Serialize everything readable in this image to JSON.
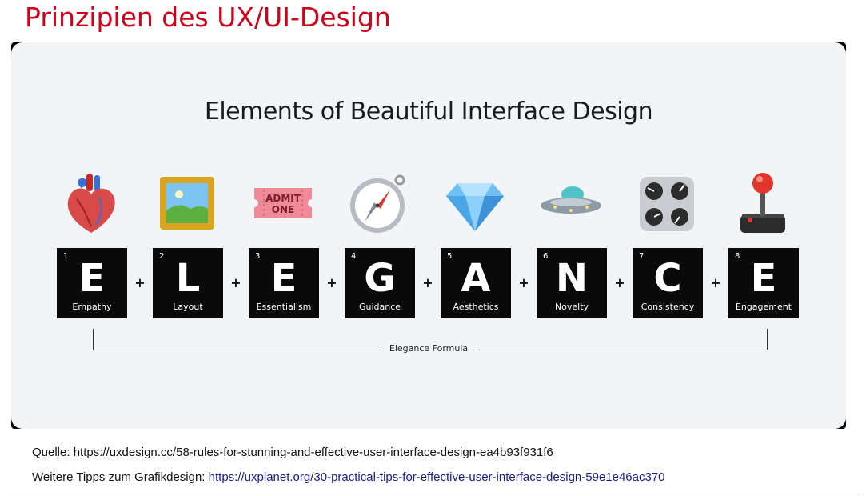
{
  "slide_title": "Prinzipien des UX/UI-Design",
  "graphic": {
    "heading": "Elements of Beautiful Interface Design",
    "operator": "+",
    "formula_label": "Elegance Formula",
    "tiles": [
      {
        "number": "1",
        "letter": "E",
        "word": "Empathy",
        "icon": "anatomical-heart-icon"
      },
      {
        "number": "2",
        "letter": "L",
        "word": "Layout",
        "icon": "framed-picture-icon"
      },
      {
        "number": "3",
        "letter": "E",
        "word": "Essentialism",
        "icon": "admission-ticket-icon",
        "icon_text": "ADMIT ONE"
      },
      {
        "number": "4",
        "letter": "G",
        "word": "Guidance",
        "icon": "compass-icon"
      },
      {
        "number": "5",
        "letter": "A",
        "word": "Aesthetics",
        "icon": "gem-icon"
      },
      {
        "number": "6",
        "letter": "N",
        "word": "Novelty",
        "icon": "flying-saucer-icon"
      },
      {
        "number": "7",
        "letter": "C",
        "word": "Consistency",
        "icon": "control-knobs-icon"
      },
      {
        "number": "8",
        "letter": "E",
        "word": "Engagement",
        "icon": "joystick-icon"
      }
    ]
  },
  "source": {
    "text": "Quelle: https://uxdesign.cc/58-rules-for-stunning-and-effective-user-interface-design-ea4b93f931f6"
  },
  "tips": {
    "prefix": "Weitere Tipps zum Grafikdesign: ",
    "link": "https://uxplanet.org/30-practical-tips-for-effective-user-interface-design-59e1e46ac370"
  },
  "colors": {
    "title": "#d0021b",
    "panel": "#f2f5f8",
    "tile": "#0a0a0a",
    "link": "#1a1a8c"
  }
}
